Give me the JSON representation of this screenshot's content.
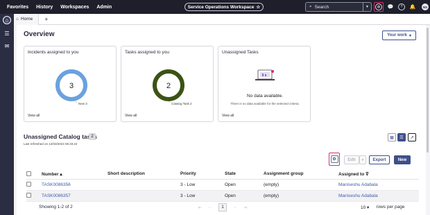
{
  "topbar": {
    "nav": [
      "Favorites",
      "History",
      "Workspaces",
      "Admin"
    ],
    "workspace_label": "Service Operations Workspace",
    "search_placeholder": "Search",
    "user_initials": "NS"
  },
  "tabs": [
    {
      "label": "Home"
    }
  ],
  "overview": {
    "title": "Overview",
    "your_work_label": "Your work",
    "cards": [
      {
        "title": "Incidents assigned to you",
        "value": "3",
        "legend": "New  3",
        "view_all": "View all",
        "color": "#6aa2de"
      },
      {
        "title": "Tasks assigned to you",
        "value": "2",
        "legend": "Catalog Task  2",
        "view_all": "View all",
        "color": "#3b5314"
      },
      {
        "title": "Unassigned Tasks",
        "nodata_title": "No data available.",
        "nodata_sub": "There is no data available for the selected criteria.",
        "view_all": "View all"
      }
    ]
  },
  "catalog": {
    "title": "Unassigned Catalog tasks",
    "count": "2",
    "refreshed": "Last refreshed on 12/03/2024 06:33:22",
    "buttons": {
      "edit": "Edit",
      "export": "Export",
      "new": "New"
    },
    "columns": [
      "Number",
      "Short description",
      "Priority",
      "State",
      "Assignment group",
      "Assigned to"
    ],
    "rows": [
      {
        "number": "TASK0086356",
        "short_description": "",
        "priority": "3 - Low",
        "state": "Open",
        "assignment_group": "(empty)",
        "assigned_to": "Maniseshu Adabala"
      },
      {
        "number": "TASK0086357",
        "short_description": "",
        "priority": "3 - Low",
        "state": "Open",
        "assignment_group": "(empty)",
        "assigned_to": "Maniseshu Adabala"
      }
    ],
    "footer": {
      "showing": "Showing 1-2 of 2",
      "page": "1",
      "rows_per_page_value": "10",
      "rows_per_page_label": "rows per page"
    }
  },
  "colors": {
    "accent": "#3e4f8a",
    "highlight": "#d0306b"
  }
}
